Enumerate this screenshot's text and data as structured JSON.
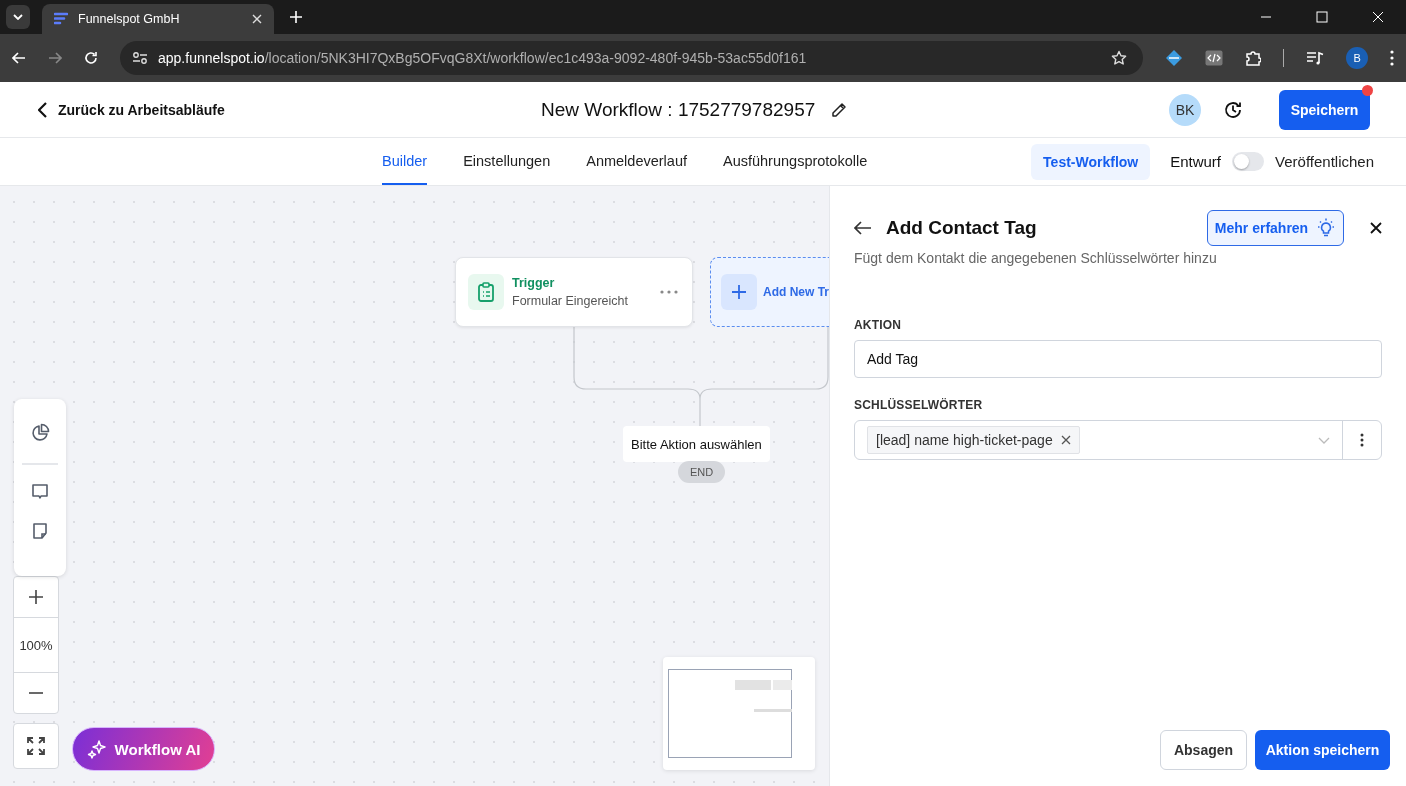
{
  "browser": {
    "tab_title": "Funnelspot GmbH",
    "url_host": "app.funnelspot.io",
    "url_path": "/location/5NK3HI7QxBg5OFvqG8Xt/workflow/ec1c493a-9092-480f-945b-53ac55d0f161",
    "profile": "B"
  },
  "header": {
    "back_label": "Zurück zu Arbeitsabläufe",
    "title": "New Workflow : 1752779782957",
    "avatar": "BK",
    "save_label": "Speichern",
    "unsaved": true
  },
  "nav": {
    "tabs": [
      {
        "label": "Builder",
        "selected": true
      },
      {
        "label": "Einstellungen",
        "selected": false
      },
      {
        "label": "Anmeldeverlauf",
        "selected": false
      },
      {
        "label": "Ausführungsprotokolle",
        "selected": false
      }
    ],
    "test_button": "Test-Workflow",
    "toggle": {
      "label_off": "Entwurf",
      "label_on": "Veröffentlichen",
      "on": false
    }
  },
  "canvas": {
    "trigger": {
      "title": "Trigger",
      "subtitle": "Formular Eingereicht"
    },
    "add_trigger": "Add New Tr",
    "action_placeholder": "Bitte Aktion auswählen",
    "end_label": "END",
    "zoom_level": "100%",
    "ai_button": "Workflow AI"
  },
  "panel": {
    "title": "Add Contact Tag",
    "description": "Fügt dem Kontakt die angegebenen Schlüsselwörter hinzu",
    "learn_more": "Mehr erfahren",
    "fields": [
      {
        "label": "AKTION",
        "kind": "text",
        "value": "Add Tag"
      },
      {
        "label": "SCHLÜSSELWÖRTER",
        "kind": "tags",
        "tags": [
          "[lead] name high-ticket-page"
        ]
      }
    ],
    "cancel": "Absagen",
    "submit": "Aktion speichern"
  }
}
